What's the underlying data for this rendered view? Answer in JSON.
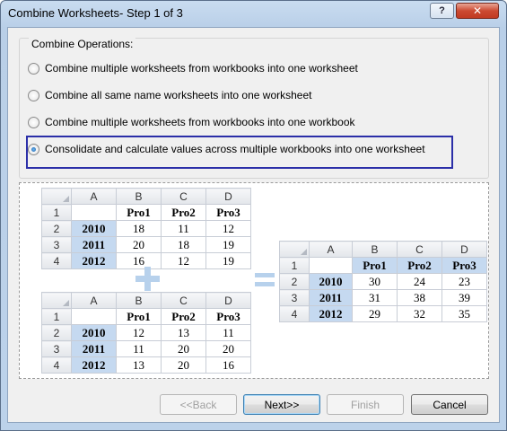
{
  "window": {
    "title": "Combine Worksheets- Step 1 of 3",
    "help_label": "?",
    "close_label": "✕"
  },
  "group": {
    "label": "Combine Operations:",
    "options": [
      {
        "label": "Combine multiple worksheets from workbooks into one worksheet",
        "checked": false
      },
      {
        "label": "Combine all same name worksheets into one worksheet",
        "checked": false
      },
      {
        "label": "Combine multiple worksheets from workbooks into one workbook",
        "checked": false
      },
      {
        "label": "Consolidate and calculate values across multiple workbooks into one worksheet",
        "checked": true
      }
    ]
  },
  "preview": {
    "col_headers": [
      "A",
      "B",
      "C",
      "D"
    ],
    "row_headers": [
      "1",
      "2",
      "3",
      "4"
    ],
    "product_headers": [
      "Pro1",
      "Pro2",
      "Pro3"
    ],
    "years": [
      "2010",
      "2011",
      "2012"
    ],
    "sheet1": [
      [
        "18",
        "11",
        "12"
      ],
      [
        "20",
        "18",
        "19"
      ],
      [
        "16",
        "12",
        "19"
      ]
    ],
    "sheet2": [
      [
        "12",
        "13",
        "11"
      ],
      [
        "11",
        "20",
        "20"
      ],
      [
        "13",
        "20",
        "16"
      ]
    ],
    "result": [
      [
        "30",
        "24",
        "23"
      ],
      [
        "31",
        "38",
        "39"
      ],
      [
        "29",
        "32",
        "35"
      ]
    ],
    "highlight_color": "#c5d9f0",
    "operator_color": "#b7d1ec"
  },
  "buttons": {
    "back": "<<Back",
    "next": "Next>>",
    "finish": "Finish",
    "cancel": "Cancel"
  }
}
